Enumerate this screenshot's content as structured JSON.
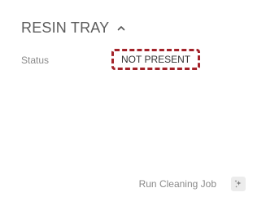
{
  "panel": {
    "title": "RESIN TRAY",
    "collapse_icon": "chevron-up-icon"
  },
  "status": {
    "label": "Status",
    "value": "NOT PRESENT",
    "value_border_color": "#a3232a"
  },
  "actions": {
    "cleaning_label": "Run Cleaning Job",
    "cleaning_icon": "sparkle-icon"
  }
}
